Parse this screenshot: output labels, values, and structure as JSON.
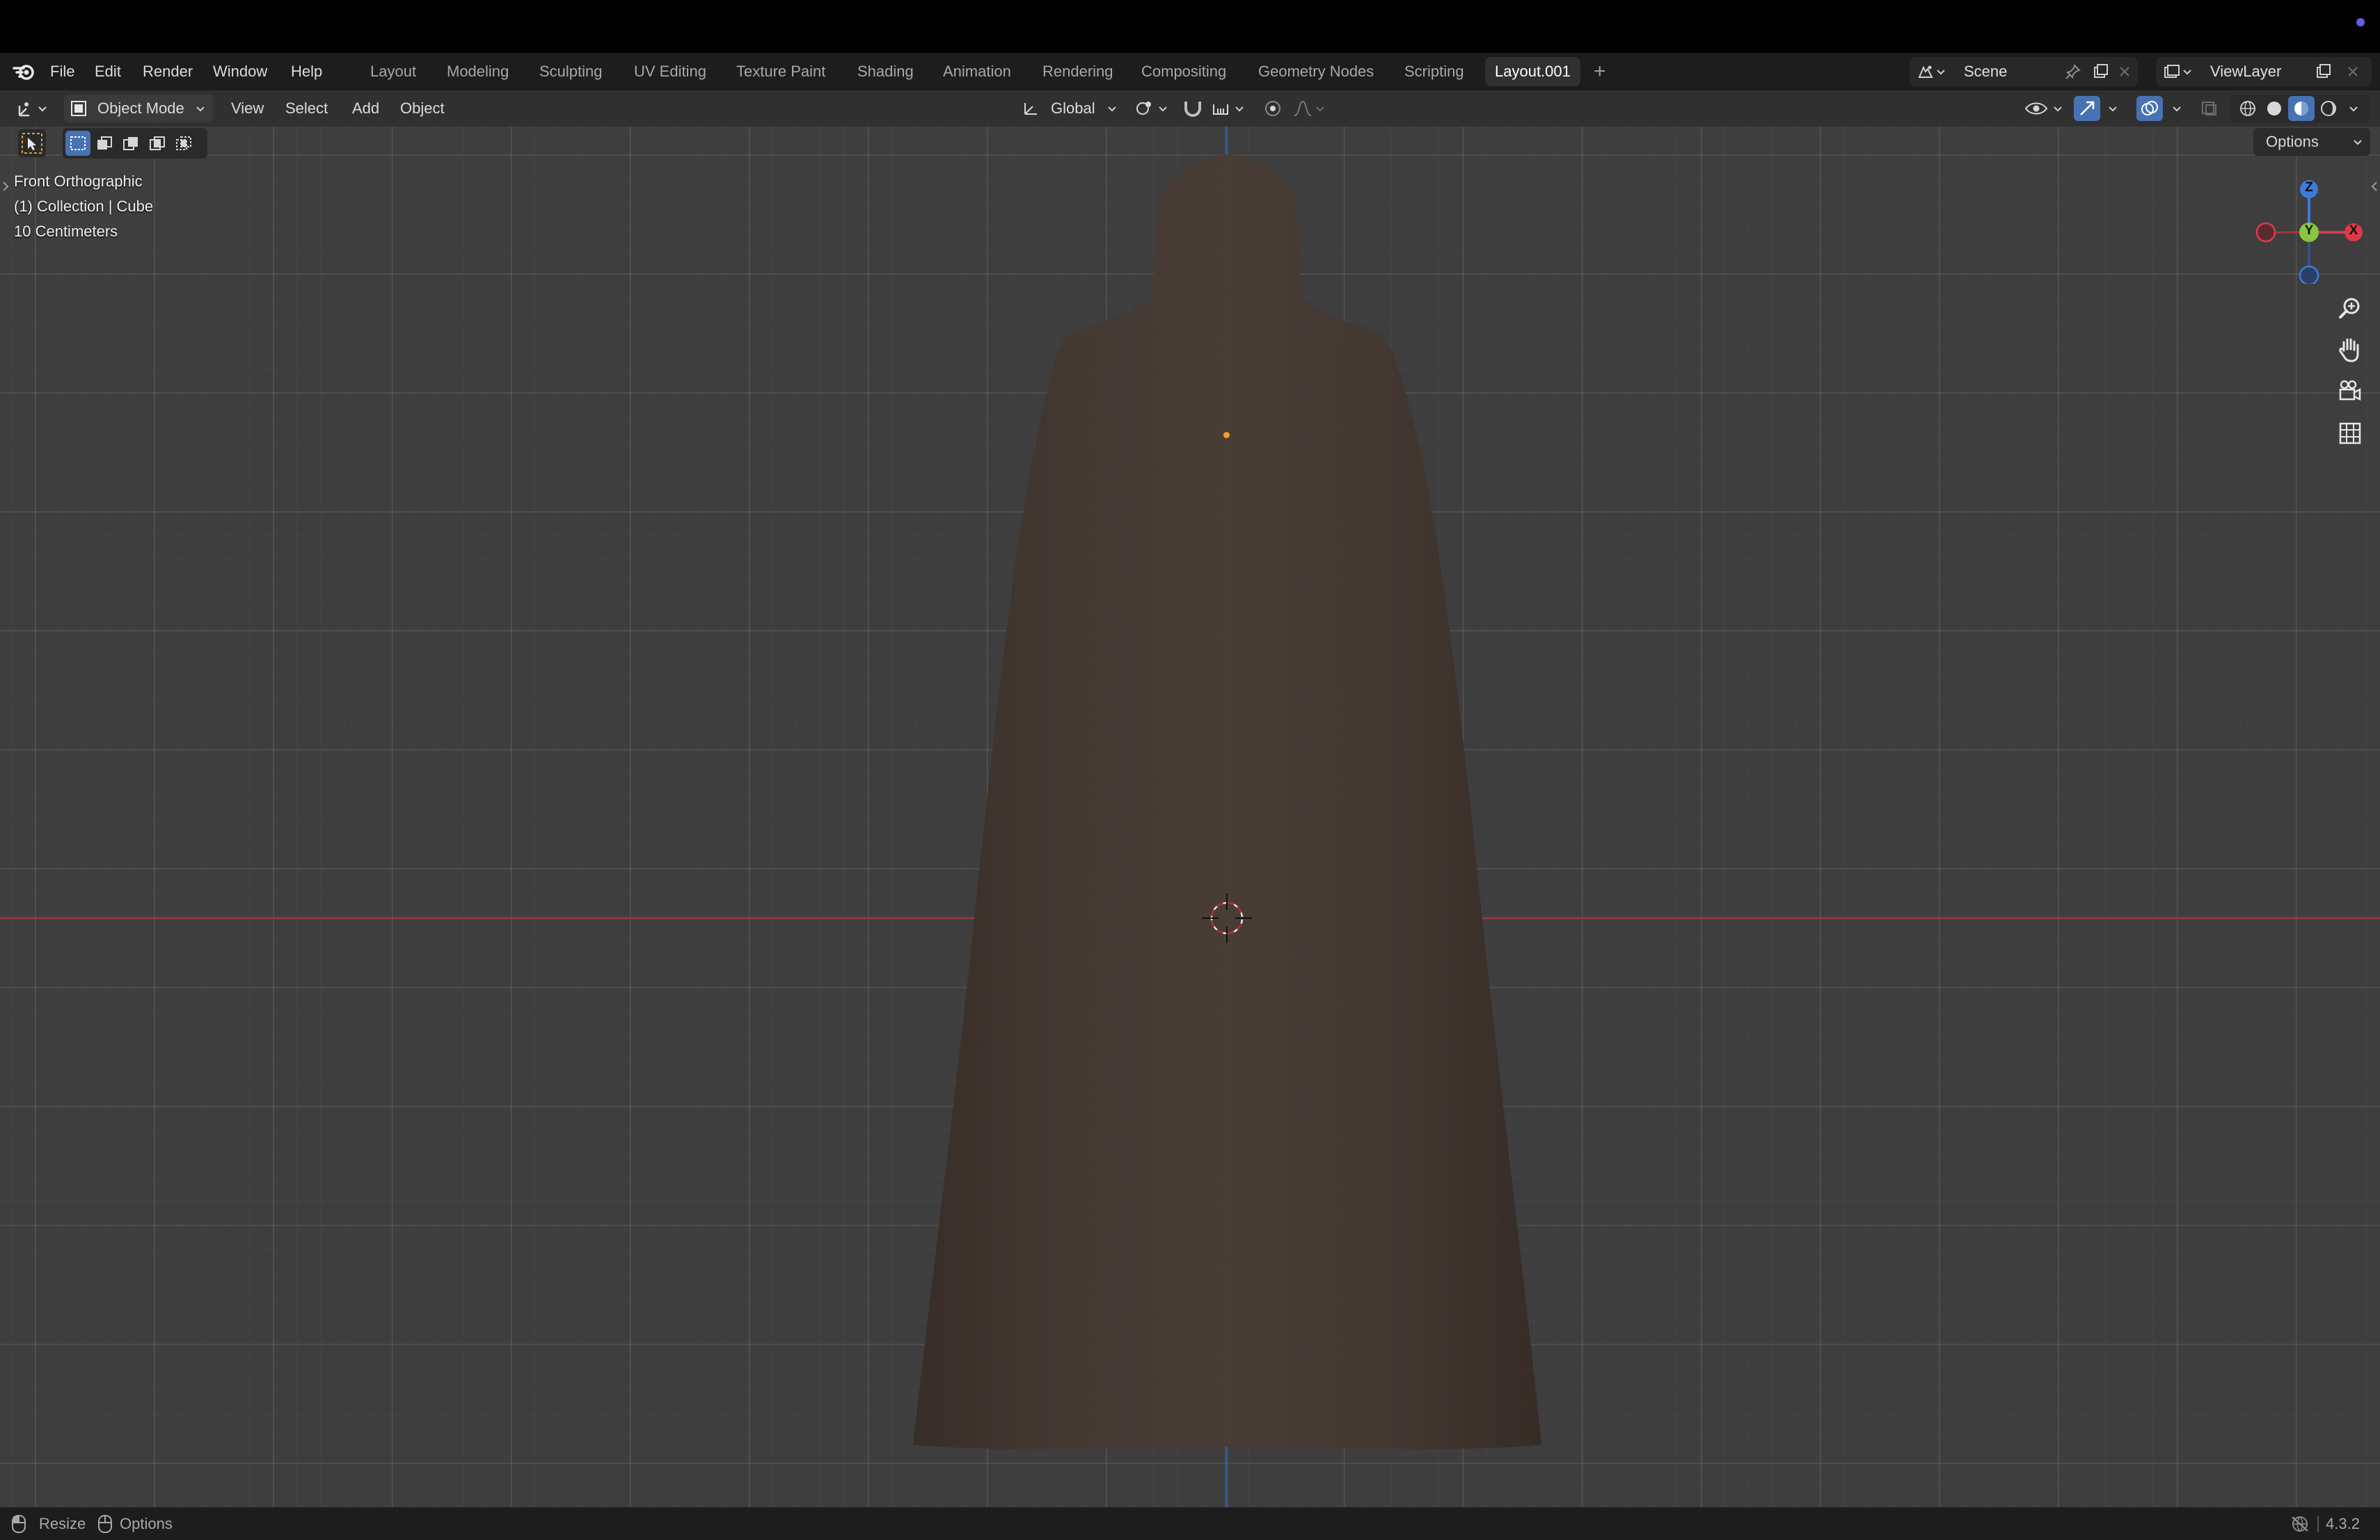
{
  "menu": {
    "items": [
      "File",
      "Edit",
      "Render",
      "Window",
      "Help"
    ]
  },
  "workspaces": {
    "tabs": [
      "Layout",
      "Modeling",
      "Sculpting",
      "UV Editing",
      "Texture Paint",
      "Shading",
      "Animation",
      "Rendering",
      "Compositing",
      "Geometry Nodes",
      "Scripting",
      "Layout.001"
    ],
    "active": "Layout.001",
    "add_symbol": "+"
  },
  "scene": {
    "name": "Scene"
  },
  "view_layer": {
    "name": "ViewLayer"
  },
  "viewport_header": {
    "mode": "Object Mode",
    "menus": [
      "View",
      "Select",
      "Add",
      "Object"
    ],
    "transform_orientation": "Global"
  },
  "viewport": {
    "view_name": "Front Orthographic",
    "collection_info": "(1) Collection | Cube",
    "scale_info": "10 Centimeters",
    "options_label": "Options",
    "gizmo_axes": {
      "z": "Z",
      "y": "Y",
      "x": "X"
    }
  },
  "status": {
    "left_items": [
      "Resize",
      "Options"
    ],
    "version": "4.3.2"
  },
  "colors": {
    "accent_blue": "#4772b3",
    "x_axis": "#e0384a",
    "y_axis": "#8bc43f",
    "z_axis": "#3d7bd9",
    "cloak": "#4c4039"
  }
}
